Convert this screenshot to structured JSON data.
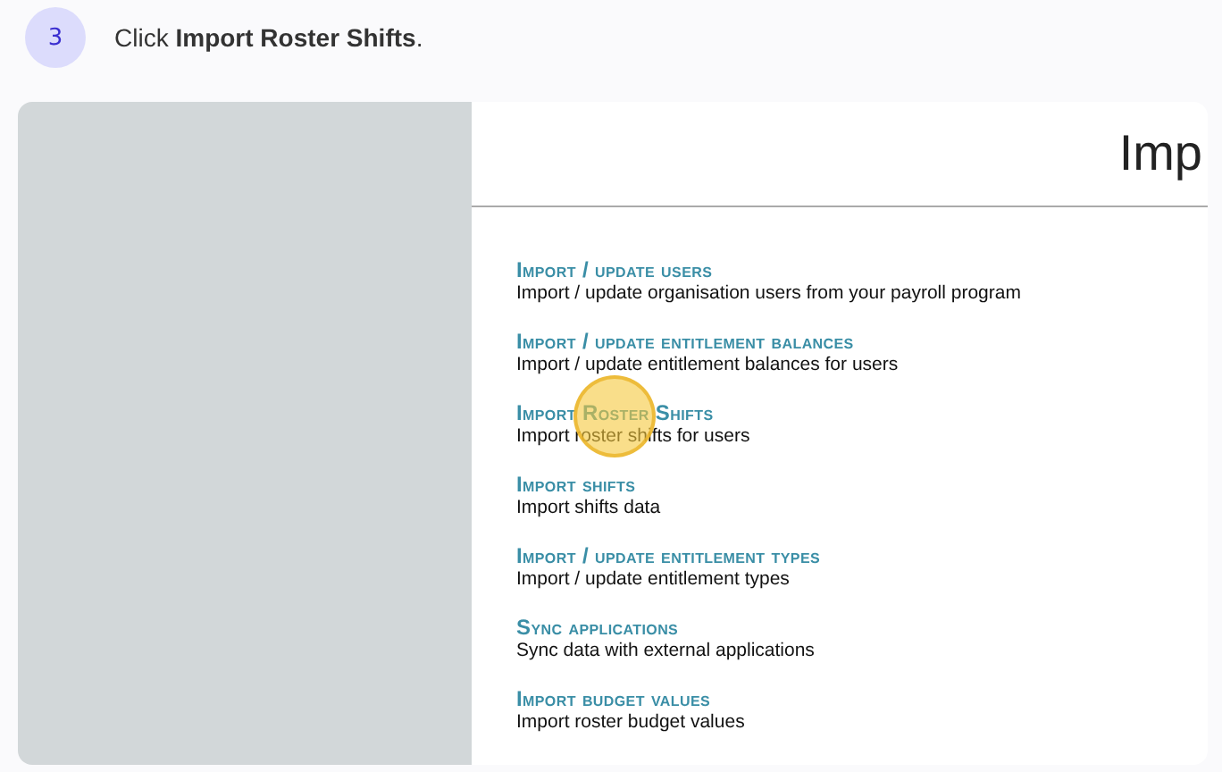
{
  "step": {
    "number": "3",
    "instruction": "Click **Import Roster Shifts**."
  },
  "page": {
    "title": "Imp",
    "items": [
      {
        "title": "Import / update users",
        "description": "Import / update organisation users from your payroll program",
        "highlighted": false
      },
      {
        "title": "Import / update entitlement balances",
        "description": "Import / update entitlement balances for users",
        "highlighted": false
      },
      {
        "title": "Import Roster Shifts",
        "description": "Import roster shifts for users",
        "highlighted": true
      },
      {
        "title": "Import shifts",
        "description": "Import shifts data",
        "highlighted": false
      },
      {
        "title": "Import / update entitlement types",
        "description": "Import / update entitlement types",
        "highlighted": false
      },
      {
        "title": "Sync applications",
        "description": "Sync data with external applications",
        "highlighted": false
      },
      {
        "title": "Import budget values",
        "description": "Import roster budget values",
        "highlighted": false
      }
    ]
  }
}
